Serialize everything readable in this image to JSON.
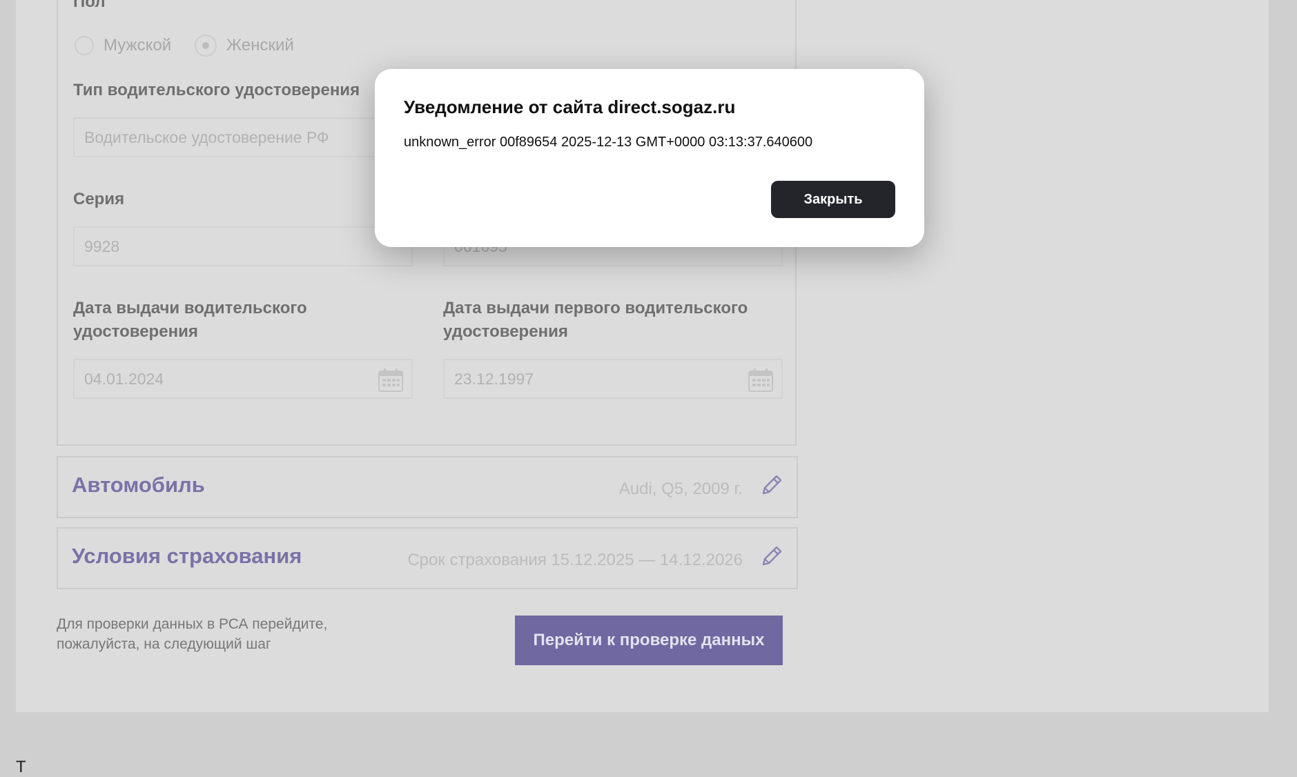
{
  "form": {
    "gender": {
      "label": "Пол",
      "options": [
        "Мужской",
        "Женский"
      ],
      "selected": "Женский"
    },
    "license_type": {
      "label": "Тип водительского удостоверения",
      "value": "Водительское удостоверение РФ"
    },
    "series": {
      "label": "Серия",
      "value": "9928"
    },
    "number": {
      "value": "061695"
    },
    "issue_date": {
      "label_line1": "Дата выдачи водительского",
      "label_line2": "удостоверения",
      "value": "04.01.2024"
    },
    "first_issue_date": {
      "label_line1": "Дата выдачи первого водительского",
      "label_line2": "удостоверения",
      "value": "23.12.1997"
    }
  },
  "sections": {
    "car": {
      "title": "Автомобиль",
      "summary": "Audi, Q5, 2009 г."
    },
    "insurance": {
      "title": "Условия страхования",
      "summary": "Срок страхования 15.12.2025 — 14.12.2026"
    }
  },
  "hint": {
    "line1": "Для проверки данных в РСА перейдите,",
    "line2": "пожалуйста, на следующий шаг"
  },
  "next_button": "Перейти к проверке данных",
  "footer_text": "Т",
  "dialog": {
    "title": "Уведомление от сайта direct.sogaz.ru",
    "message": "unknown_error 00f89654 2025-12-13 GMT+0000 03:13:37.640600",
    "close_label": "Закрыть"
  },
  "colors": {
    "accent": "#6f68a1",
    "section_title": "#7a72a7",
    "dialog_button": "#24242b",
    "overlay_bg": "#dcdcdc"
  }
}
